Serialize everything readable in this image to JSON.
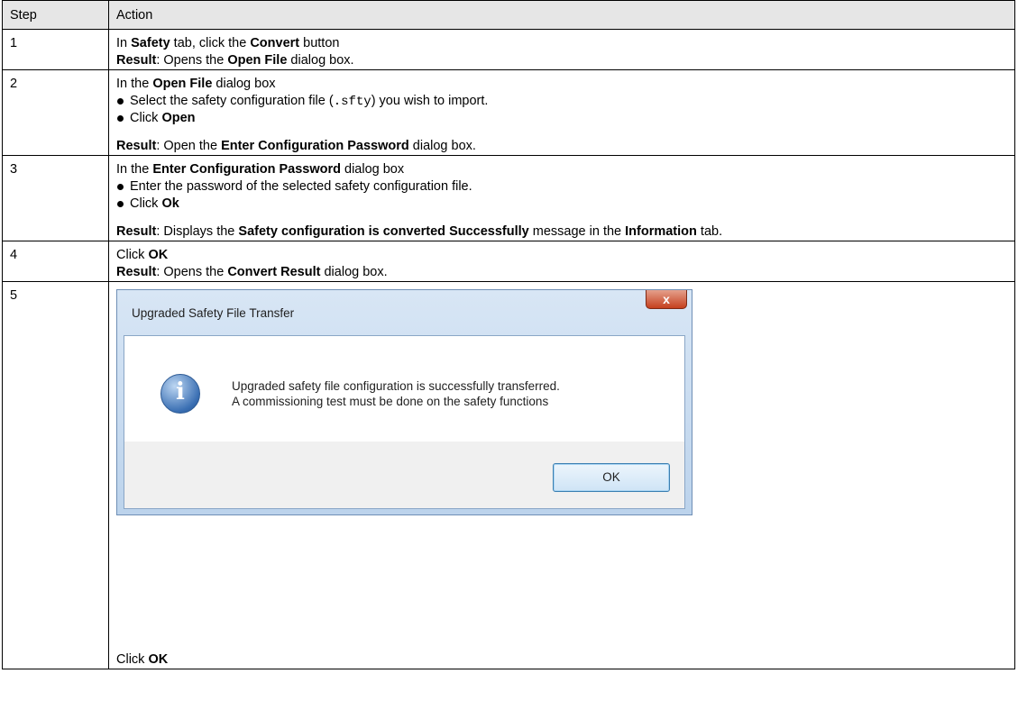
{
  "table": {
    "headers": {
      "step": "Step",
      "action": "Action"
    },
    "rows": [
      {
        "step": "1",
        "line1": {
          "pre": "In ",
          "b1": "Safety",
          "mid": " tab, click the ",
          "b2": "Convert",
          "post": " button"
        },
        "result": {
          "label": "Result",
          "pre": ": Opens the ",
          "b1": "Open File",
          "post": " dialog box."
        }
      },
      {
        "step": "2",
        "intro": {
          "pre": "In the ",
          "b1": "Open File",
          "post": " dialog box"
        },
        "bullet1": {
          "pre": "Select the safety configuration file (",
          "code": ".sfty",
          "post": ") you wish to import."
        },
        "bullet2": {
          "pre": "Click ",
          "b1": "Open"
        },
        "result": {
          "label": "Result",
          "pre": ": Open the ",
          "b1": "Enter Configuration Password",
          "post": " dialog box."
        }
      },
      {
        "step": "3",
        "intro": {
          "pre": "In the ",
          "b1": "Enter Configuration Password",
          "post": " dialog box"
        },
        "bullet1": {
          "pre": "Enter the password of the selected safety configuration file."
        },
        "bullet2": {
          "pre": "Click ",
          "b1": "Ok"
        },
        "result": {
          "label": "Result",
          "pre": ": Displays the ",
          "b1": "Safety configuration is converted Successfully",
          "mid": " message in the ",
          "b2": "Information",
          "post": " tab."
        }
      },
      {
        "step": "4",
        "line1": {
          "pre": "Click ",
          "b1": "OK"
        },
        "result": {
          "label": "Result",
          "pre": ": Opens the ",
          "b1": "Convert Result",
          "post": " dialog box."
        }
      },
      {
        "step": "5",
        "dialog": {
          "title": "Upgraded Safety File Transfer",
          "close": "x",
          "icon": "info-icon",
          "message_line1": "Upgraded safety file configuration is successfully transferred.",
          "message_line2": "A commissioning test must be done on the safety functions",
          "ok_label": "OK"
        },
        "final": {
          "pre": "Click ",
          "b1": "OK"
        }
      }
    ]
  }
}
